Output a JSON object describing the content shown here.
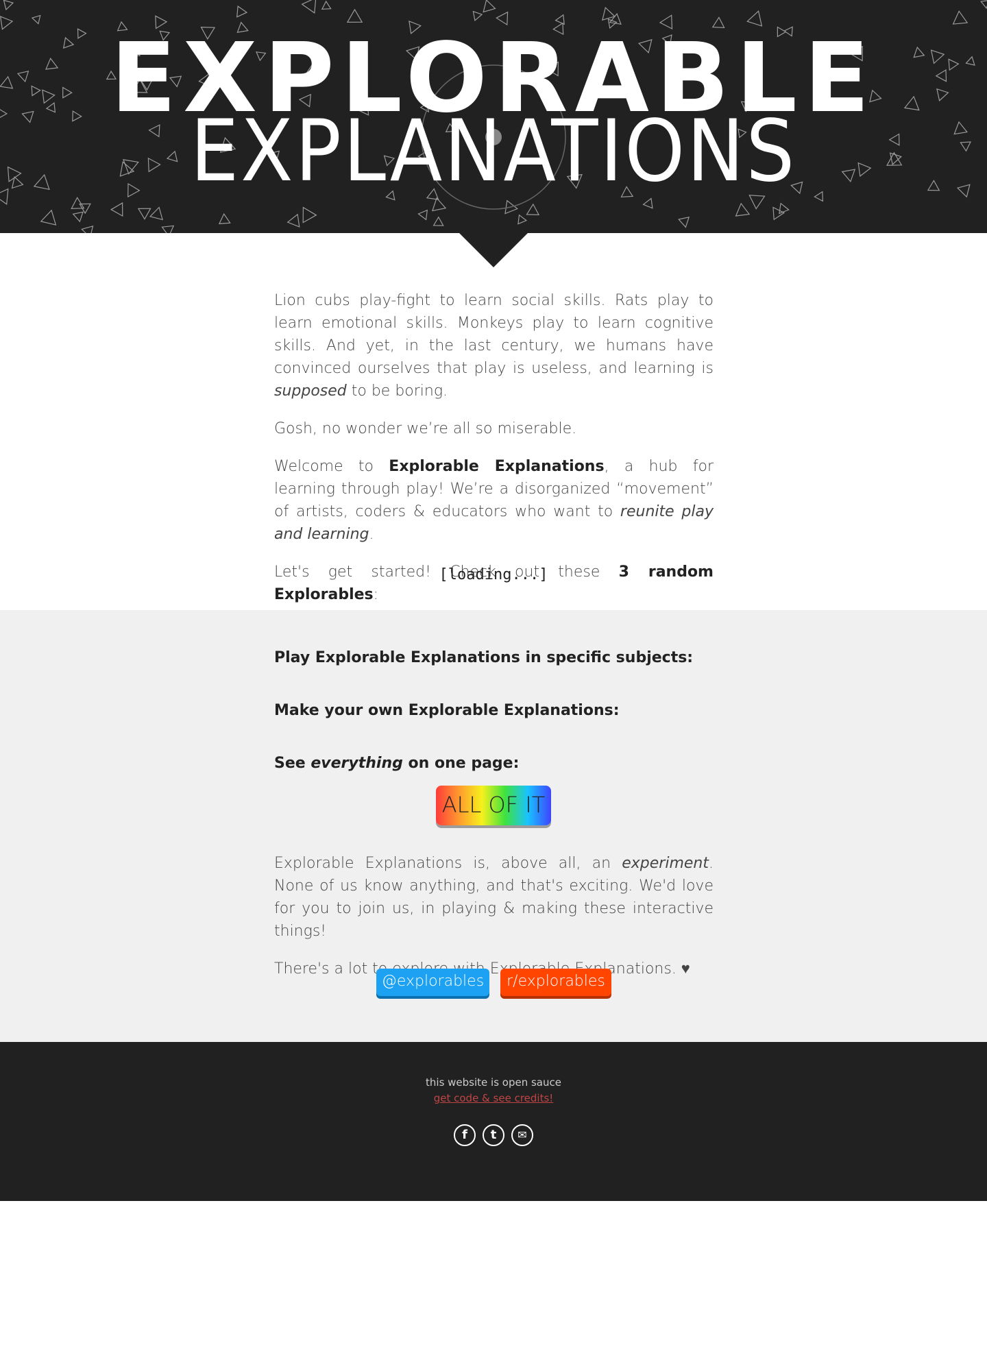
{
  "header": {
    "title_line1": "EXPLORABLE",
    "title_line2": "EXPLANATIONS"
  },
  "intro": {
    "p1_a": "Lion cubs play-fight to learn social skills. Rats play to learn emotional skills. Monkeys play to learn cognitive skills. And yet, in the last century, we humans have convinced ourselves that play is useless, and learning is ",
    "p1_em": "supposed",
    "p1_b": " to be boring.",
    "p2": "Gosh, no wonder we’re all so miserable.",
    "p3_a": "Welcome to ",
    "p3_bold": "Explorable Explanations",
    "p3_b": ", a hub for learning through play! We’re a disorganized “movement” of artists, coders & educators who want to ",
    "p3_em": "reunite play and learning",
    "p3_c": ".",
    "p4_a": "Let's get started! Check out these ",
    "p4_bold": "3 random Explorables",
    "p4_b": ":",
    "loading": "[loading...]"
  },
  "sections": {
    "subjects_heading": "Play Explorable Explanations in specific subjects:",
    "make_heading": "Make your own Explorable Explanations:",
    "see_a": "See ",
    "see_em": "everything",
    "see_b": " on one page:",
    "all_button": "ALL OF IT"
  },
  "outro": {
    "p1_a": "Explorable Explanations is, above all, an ",
    "p1_em": "experiment",
    "p1_b": ". None of us know anything, and that's exciting. We'd love for you to join us, in playing & making these interactive things!",
    "p2": "There's a lot to explore with Explorable Explanations. ♥",
    "twitter_label": "@explorables",
    "reddit_label": "r/explorables"
  },
  "footer": {
    "sauce": "this website is open sauce",
    "credits_link": "get code & see credits!",
    "social_icons": [
      "facebook-icon",
      "twitter-icon",
      "email-icon"
    ],
    "facebook_glyph": "f",
    "twitter_glyph": "t",
    "email_glyph": "✉"
  },
  "colors": {
    "dark": "#212121",
    "grey": "#f0f0f0",
    "twitter": "#1da1f2",
    "reddit": "#ff4500",
    "link": "#c04545"
  }
}
